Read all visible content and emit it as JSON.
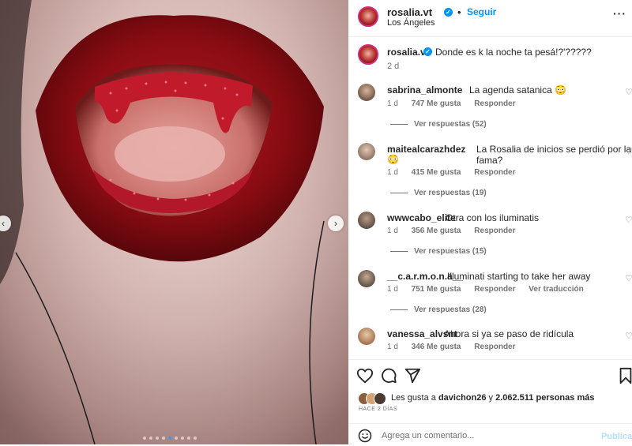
{
  "post": {
    "username": "rosalia.vt",
    "location": "Los Ángeles",
    "follow_label": "Seguir",
    "separator": "•",
    "more_label": "···",
    "caption": "Donde es k la noche ta pesá!?'?????",
    "caption_age": "2 d"
  },
  "comments": [
    {
      "user": "sabrina_almonte",
      "text": "La agenda satanica 😳",
      "age": "1 d",
      "likes": "747 Me gusta",
      "reply": "Responder",
      "replies": "Ver respuestas (52)"
    },
    {
      "user": "maitealcarazhdez",
      "text": "La Rosalia de inicios se perdió por la fama?",
      "text2": "😳",
      "age": "1 d",
      "likes": "415 Me gusta",
      "reply": "Responder",
      "replies": "Ver respuestas (19)"
    },
    {
      "user": "wwwcabo_elite",
      "text": "Otra con los iluminatis",
      "age": "1 d",
      "likes": "356 Me gusta",
      "reply": "Responder",
      "replies": "Ver respuestas (15)"
    },
    {
      "user": "__c.a.r.m.o.n.a__",
      "text": "Illuminati starting to take her away",
      "age": "1 d",
      "likes": "751 Me gusta",
      "reply": "Responder",
      "translate": "Ver traducción",
      "replies": "Ver respuestas (28)"
    },
    {
      "user": "vanessa_alvsnt",
      "text": "Ahora si ya se paso de ridícula",
      "age": "1 d",
      "likes": "346 Me gusta",
      "reply": "Responder"
    }
  ],
  "likes": {
    "prefix": "Les gusta a",
    "user": "davichon26",
    "connector": "y",
    "count": "2.062.511 personas más"
  },
  "posted_ago": "HACE 2 DÍAS",
  "comment_box": {
    "placeholder": "Agrega un comentario...",
    "publish_label": "Publicar"
  },
  "carousel": {
    "total_slides": 9,
    "active_index": 4
  },
  "colors": {
    "accent": "#0095f6",
    "text": "#262626",
    "muted": "#737373",
    "lips": "#8e0f16"
  },
  "icons": [
    "heart-icon",
    "comment-icon",
    "share-icon",
    "save-icon",
    "emoji-icon",
    "verified-icon",
    "chevron-left-icon",
    "chevron-right-icon"
  ]
}
